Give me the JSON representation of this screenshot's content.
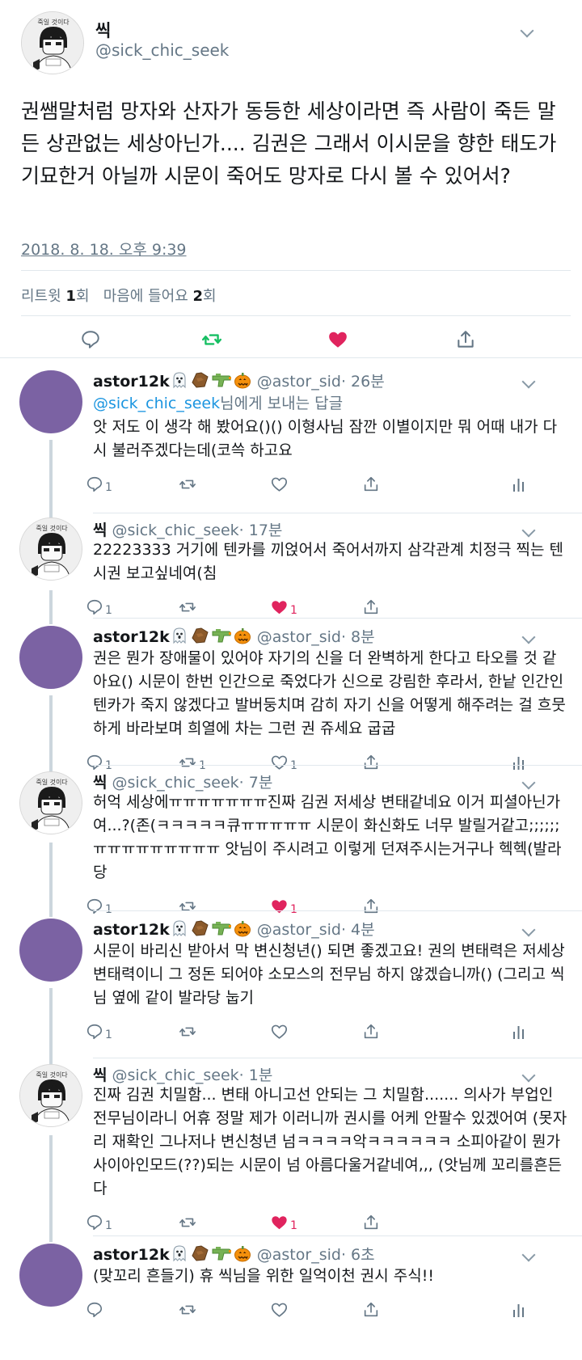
{
  "main_tweet": {
    "avatar_text": "죽일 것이다",
    "name": "씩",
    "handle": "@sick_chic_seek",
    "text": "권쌤말처럼 망자와 산자가 동등한 세상이라면 즉 사람이 죽든 말든 상관없는 세상아닌가.... 김권은 그래서 이시문을 향한 태도가 기묘한거 아닐까 시문이 죽어도 망자로 다시 볼 수 있어서?",
    "timestamp": "2018. 8. 18. 오후 9:39",
    "retweet_label": "리트윗",
    "retweet_count": "1",
    "retweet_unit": "회",
    "like_label": "마음에 들어요",
    "like_count": "2",
    "like_unit": "회"
  },
  "colors": {
    "retweet_active": "#17bf63",
    "like_active": "#e0245e",
    "link": "#1b95e0",
    "secondary": "#657786",
    "avatar_purple": "#7b62a3"
  },
  "replies": [
    {
      "name": "astor12k",
      "emojis": [
        "ghost-icon",
        "coffin-icon",
        "water-gun-icon",
        "pumpkin-icon"
      ],
      "handle": "@astor_sid",
      "time": "· 26분",
      "reply_to_user": "@sick_chic_seek",
      "reply_to_suffix": "님에게 보내는 답글",
      "text": "앗 저도 이 생각 해 봤어요()() 이형사님 잠깐 이별이지만 뭐 어때 내가 다시 불러주겠다는데(코쓱 하고요",
      "reply_count": "1",
      "retweet_count": "",
      "like_count": "",
      "liked": false
    },
    {
      "name": "씩",
      "handle": "@sick_chic_seek",
      "time": "· 17분",
      "text": "22223333 거기에 텐카를 끼얹어서 죽어서까지 삼각관계 치정극 찍는 텐시권 보고싶네여(침",
      "reply_count": "1",
      "retweet_count": "",
      "like_count": "1",
      "liked": true
    },
    {
      "name": "astor12k",
      "emojis": [
        "ghost-icon",
        "coffin-icon",
        "water-gun-icon",
        "pumpkin-icon"
      ],
      "handle": "@astor_sid",
      "time": "· 8분",
      "text": "권은 뭔가 장애물이 있어야 자기의 신을 더 완벽하게 한다고 타오를 것 같아요() 시문이 한번 인간으로 죽었다가 신으로 강림한 후라서, 한낱 인간인 텐카가 죽지 않겠다고 발버둥치며 감히 자기 신을 어떻게 해주려는 걸 흐뭇하게 바라보며 희열에 차는 그런 권 쥬세요 굽굽",
      "reply_count": "1",
      "retweet_count": "1",
      "like_count": "1",
      "liked": false
    },
    {
      "name": "씩",
      "handle": "@sick_chic_seek",
      "time": "· 7분",
      "text": "허억 세상에ㅠㅠㅠㅠㅠㅠㅠ진짜 김권 저세상 변태같네요 이거 피셜아닌가여...?(존(ㅋㅋㅋㅋㅋ큐ㅠㅠㅠㅠㅠ 시문이 화신화도 너무 발릴거같고;;;;;;ㅠㅠㅠㅠㅠㅠㅠㅠㅠ 앗님이 주시려고 이렇게 던져주시는거구나 헥헥(발라당",
      "reply_count": "1",
      "retweet_count": "",
      "like_count": "1",
      "liked": true
    },
    {
      "name": "astor12k",
      "emojis": [
        "ghost-icon",
        "coffin-icon",
        "water-gun-icon",
        "pumpkin-icon"
      ],
      "handle": "@astor_sid",
      "time": "· 4분",
      "text": "시문이 바리신 받아서 막 변신청년() 되면 좋겠고요! 권의 변태력은 저세상 변태력이니 그 정돈 되어야 소모스의 전무님 하지 않겠습니까() (그리고 씩님 옆에 같이 발라당 눕기",
      "reply_count": "1",
      "retweet_count": "",
      "like_count": "",
      "liked": false
    },
    {
      "name": "씩",
      "handle": "@sick_chic_seek",
      "time": "· 1분",
      "text": "진짜 김권 치밀함... 변태 아니고선 안되는 그 치밀함....... 의사가 부업인 전무님이라니 어휴 정말 제가 이러니까 권시를 어케 안팔수 있겠어여 (못자리 재확인 그나저나 변신청년 넘ㅋㅋㅋㅋ악ㅋㅋㅋㅋㅋㅋ 소피아같이 뭔가 사이아인모드(??)되는 시문이 넘 아름다울거같네여,,, (앗님께 꼬리를흔든다",
      "reply_count": "1",
      "retweet_count": "",
      "like_count": "1",
      "liked": true
    },
    {
      "name": "astor12k",
      "emojis": [
        "ghost-icon",
        "coffin-icon",
        "water-gun-icon",
        "pumpkin-icon"
      ],
      "handle": "@astor_sid",
      "time": "· 6초",
      "text": "(맞꼬리 흔들기) 휴 씩님을 위한 일억이천 권시 주식!!",
      "reply_count": "",
      "retweet_count": "",
      "like_count": "",
      "liked": false
    }
  ]
}
